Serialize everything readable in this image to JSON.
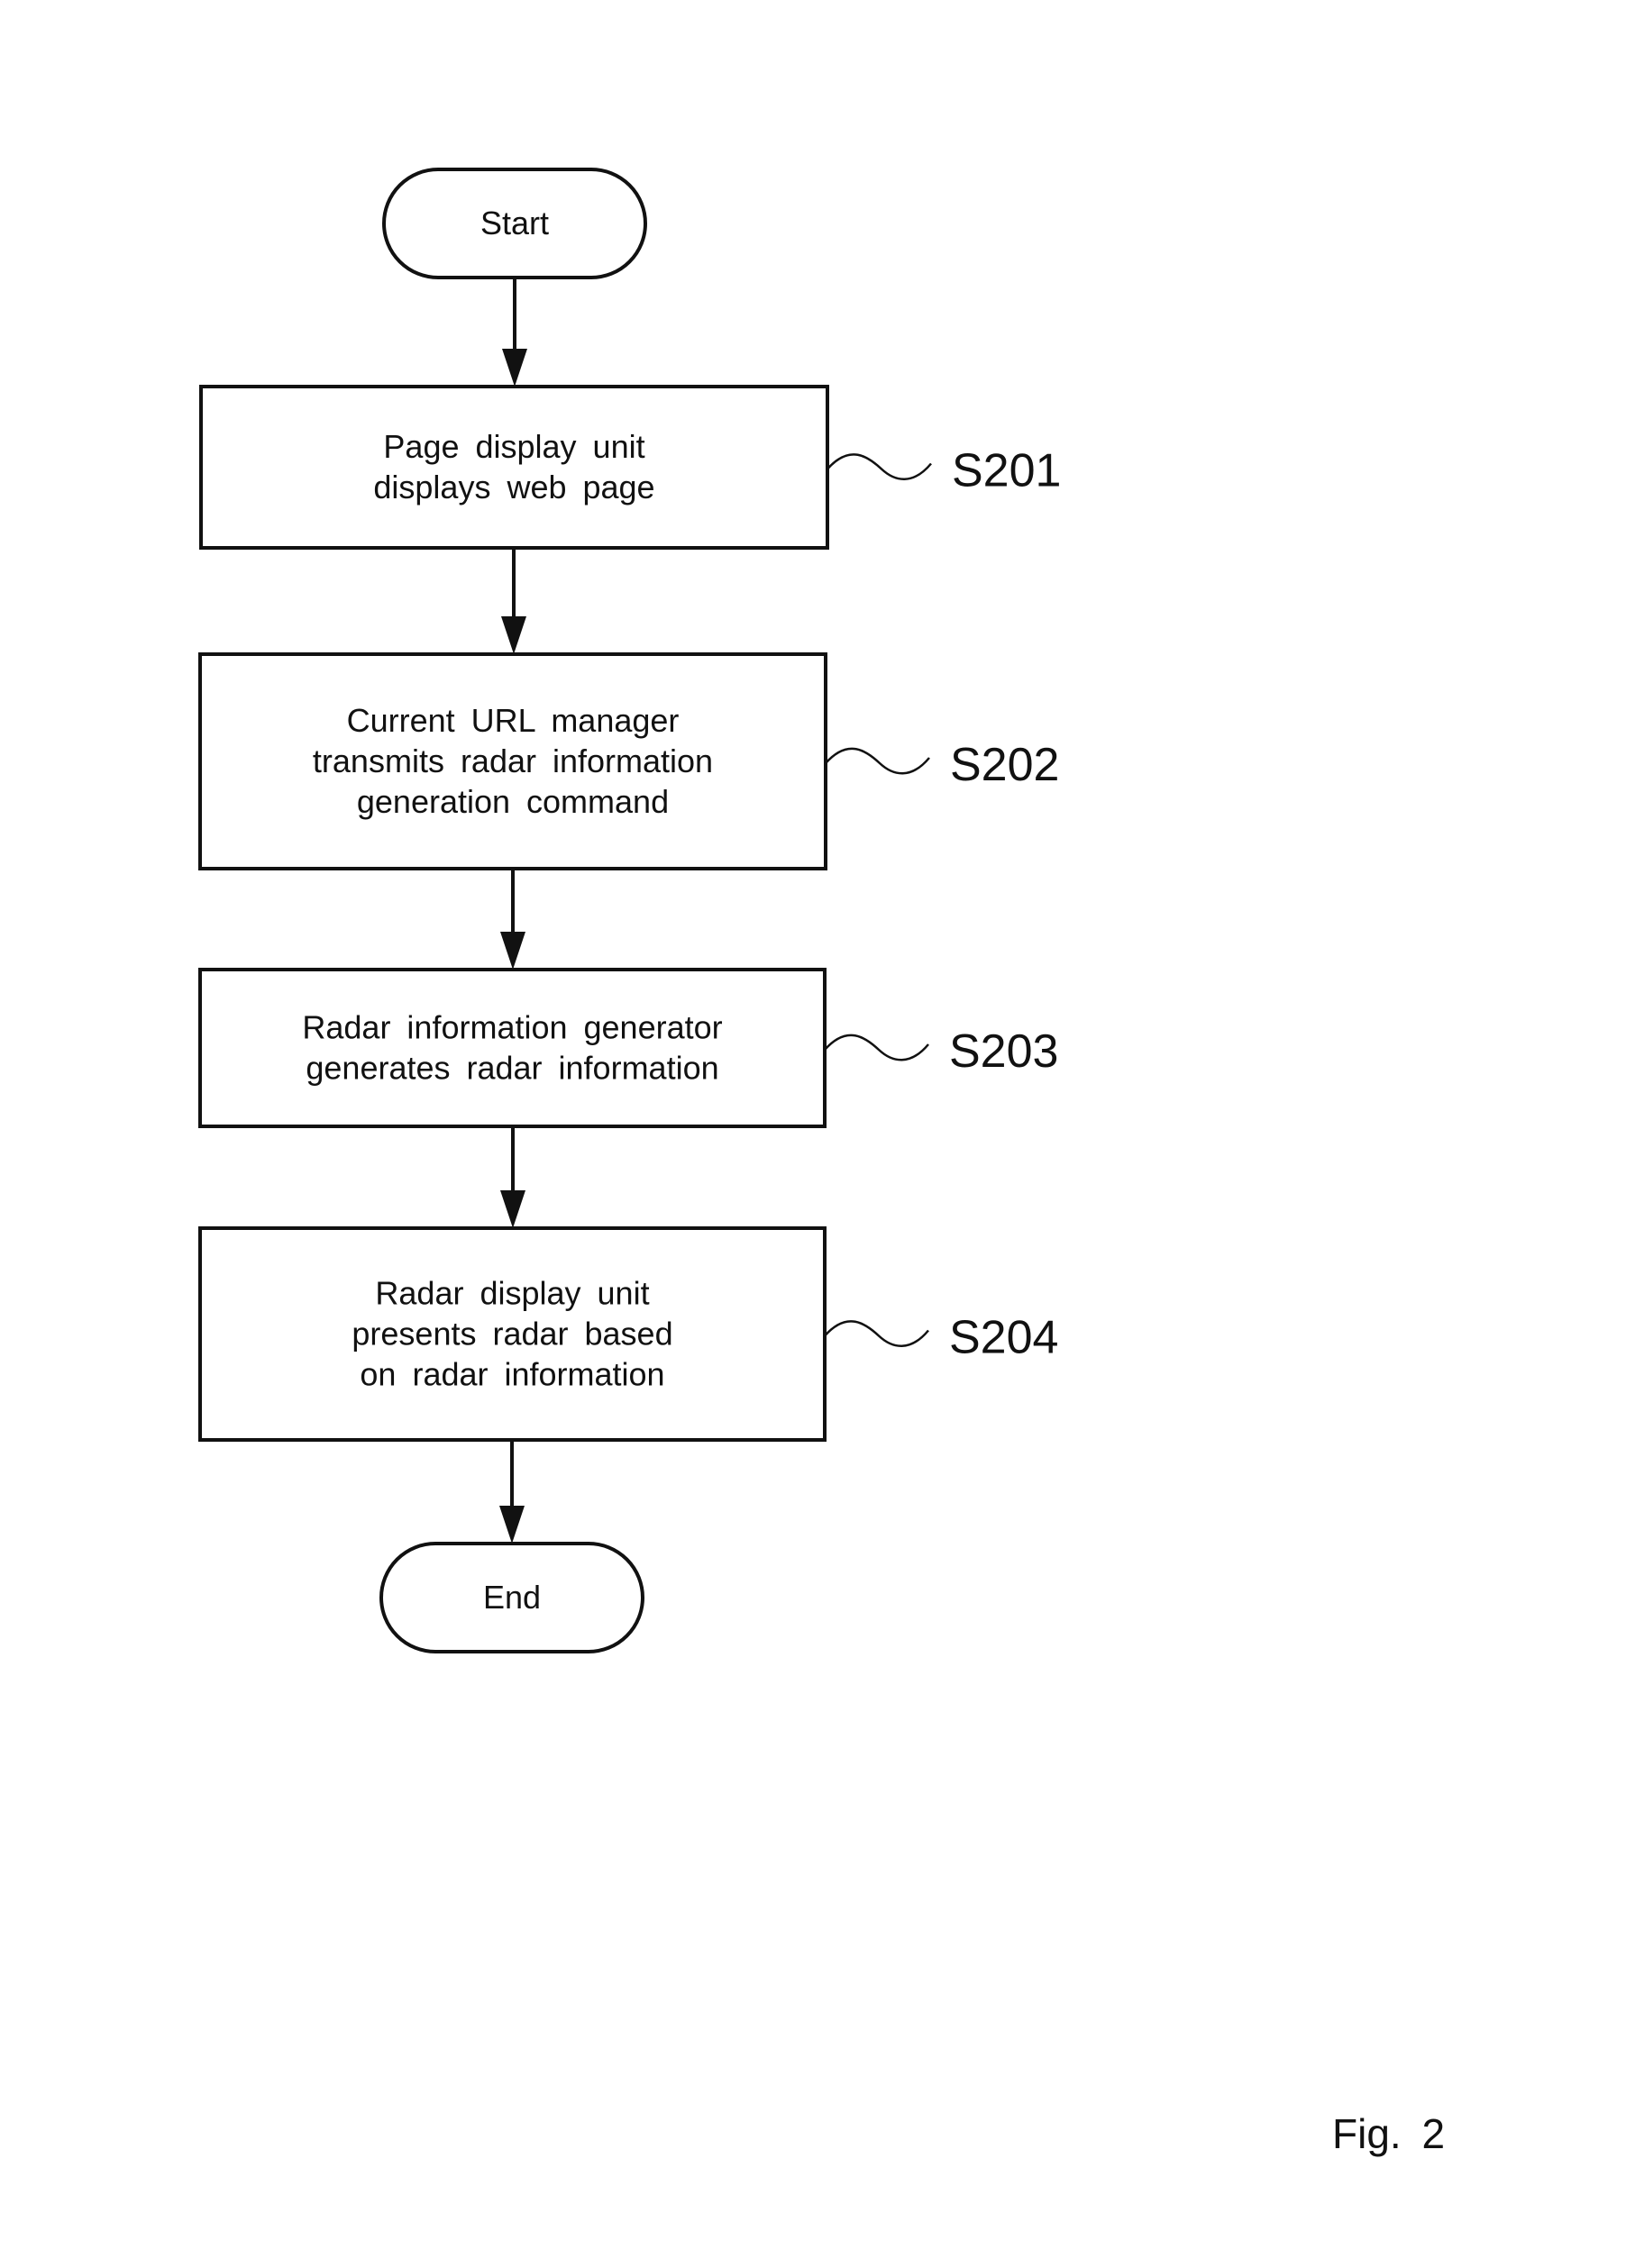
{
  "figure": {
    "caption": "Fig. 2"
  },
  "nodes": [
    {
      "id": "start",
      "type": "terminator",
      "lines": [
        "Start"
      ]
    },
    {
      "id": "s201",
      "type": "process",
      "step": "S201",
      "lines": [
        "Page display unit",
        "displays web page"
      ]
    },
    {
      "id": "s202",
      "type": "process",
      "step": "S202",
      "lines": [
        "Current URL manager",
        "transmits radar information",
        "generation command"
      ]
    },
    {
      "id": "s203",
      "type": "process",
      "step": "S203",
      "lines": [
        "Radar information generator",
        "generates radar information"
      ]
    },
    {
      "id": "s204",
      "type": "process",
      "step": "S204",
      "lines": [
        "Radar display unit",
        "presents radar based",
        "on radar information"
      ]
    },
    {
      "id": "end",
      "type": "terminator",
      "lines": [
        "End"
      ]
    }
  ],
  "edges": [
    {
      "from": "start",
      "to": "s201"
    },
    {
      "from": "s201",
      "to": "s202"
    },
    {
      "from": "s202",
      "to": "s203"
    },
    {
      "from": "s203",
      "to": "s204"
    },
    {
      "from": "s204",
      "to": "end"
    }
  ],
  "colors": {
    "stroke": "#111111",
    "background": "#ffffff"
  }
}
